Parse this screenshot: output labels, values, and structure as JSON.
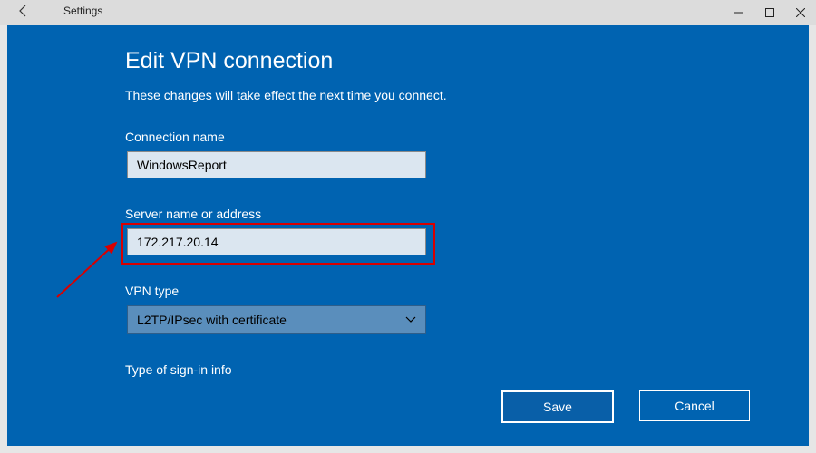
{
  "titlebar": {
    "title": "Settings"
  },
  "panel": {
    "title": "Edit VPN connection",
    "description": "These changes will take effect the next time you connect."
  },
  "fields": {
    "connection_name": {
      "label": "Connection name",
      "value": "WindowsReport"
    },
    "server": {
      "label": "Server name or address",
      "value": "172.217.20.14"
    },
    "vpn_type": {
      "label": "VPN type",
      "selected": "L2TP/IPsec with certificate"
    },
    "signin": {
      "label": "Type of sign-in info"
    }
  },
  "buttons": {
    "save": "Save",
    "cancel": "Cancel"
  }
}
